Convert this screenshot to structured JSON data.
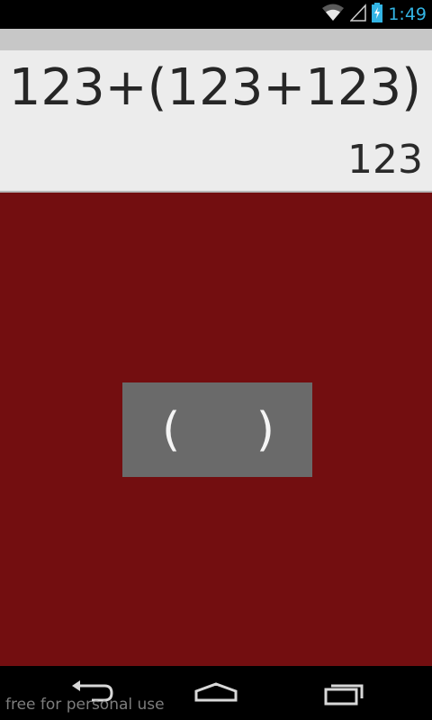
{
  "status_bar": {
    "time": "1:49",
    "icons": [
      "wifi-icon",
      "signal-icon",
      "battery-charging-icon"
    ],
    "accent_color": "#33b5e5"
  },
  "display": {
    "expression": "123+(123+123)",
    "result": "123",
    "background_color": "#ececec"
  },
  "panel": {
    "background_color": "#730e10",
    "popup": {
      "open_paren": "(",
      "close_paren": ")",
      "background_color": "#6a6a6a"
    }
  },
  "nav_bar": {
    "icons": [
      "back-icon",
      "home-icon",
      "recent-apps-icon"
    ]
  },
  "watermark": "free for personal use"
}
